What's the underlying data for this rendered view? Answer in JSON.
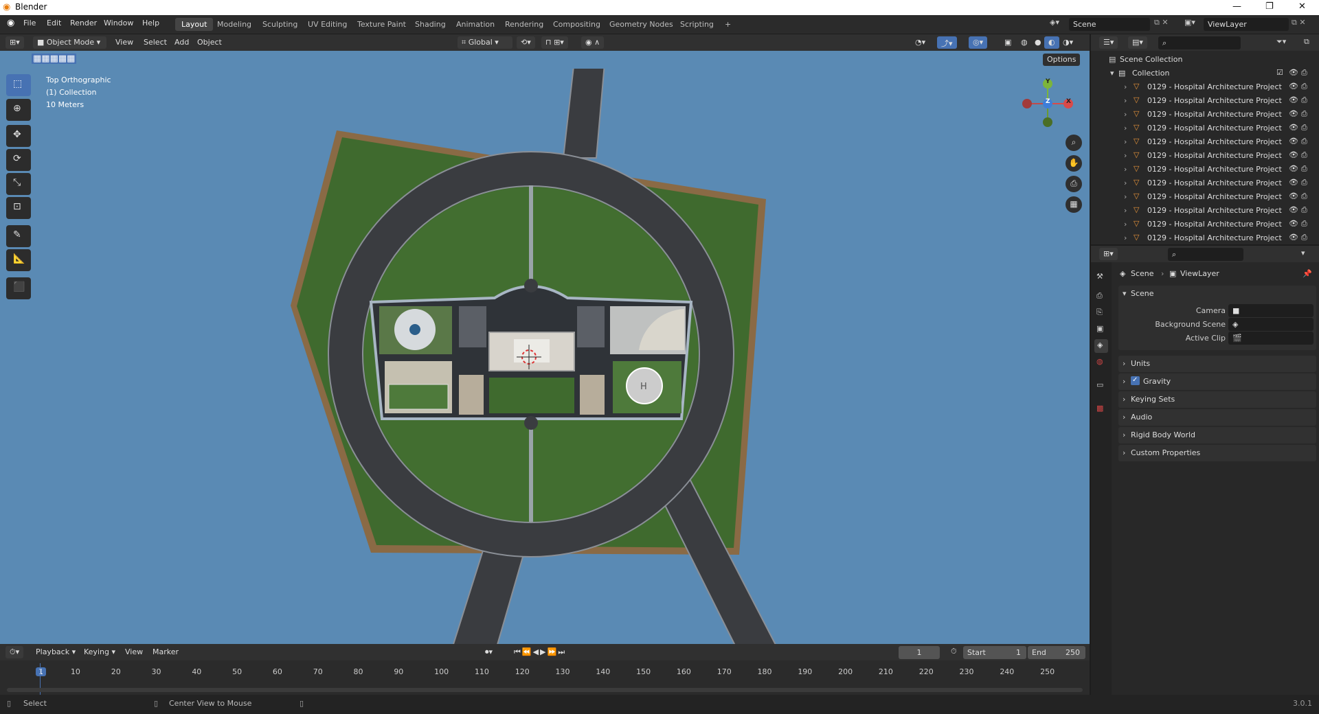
{
  "window": {
    "title": "Blender"
  },
  "menu": [
    "File",
    "Edit",
    "Render",
    "Window",
    "Help"
  ],
  "workspaces": [
    "Layout",
    "Modeling",
    "Sculpting",
    "UV Editing",
    "Texture Paint",
    "Shading",
    "Animation",
    "Rendering",
    "Compositing",
    "Geometry Nodes",
    "Scripting",
    "+"
  ],
  "active_workspace": "Layout",
  "scene_field": "Scene",
  "viewlayer_field": "ViewLayer",
  "viewport_header": {
    "mode": "Object Mode",
    "view": "View",
    "select": "Select",
    "add": "Add",
    "object": "Object",
    "transform": "Global",
    "options": "Options"
  },
  "viewport_overlay": {
    "view_name": "Top Orthographic",
    "collection": "(1) Collection",
    "scale": "10 Meters"
  },
  "gizmo": {
    "y": "Y",
    "z": "Z",
    "x": "X"
  },
  "outliner": {
    "root": "Scene Collection",
    "collection": "Collection",
    "items": [
      "0129 - Hospital Architecture Project",
      "0129 - Hospital Architecture Project",
      "0129 - Hospital Architecture Project",
      "0129 - Hospital Architecture Project",
      "0129 - Hospital Architecture Project",
      "0129 - Hospital Architecture Project",
      "0129 - Hospital Architecture Project",
      "0129 - Hospital Architecture Project",
      "0129 - Hospital Architecture Project",
      "0129 - Hospital Architecture Project",
      "0129 - Hospital Architecture Project",
      "0129 - Hospital Architecture Project"
    ]
  },
  "properties": {
    "breadcrumb_scene": "Scene",
    "breadcrumb_viewlayer": "ViewLayer",
    "section": "Scene",
    "camera_label": "Camera",
    "background_label": "Background Scene",
    "clip_label": "Active Clip",
    "panels": [
      "Units",
      "Gravity",
      "Keying Sets",
      "Audio",
      "Rigid Body World",
      "Custom Properties"
    ],
    "gravity_checked": true
  },
  "timeline": {
    "playback": "Playback",
    "keying": "Keying",
    "view": "View",
    "marker": "Marker",
    "current_frame": "1",
    "start_label": "Start",
    "start": "1",
    "end_label": "End",
    "end": "250",
    "ticks": [
      "1",
      "10",
      "20",
      "30",
      "40",
      "50",
      "60",
      "70",
      "80",
      "90",
      "100",
      "110",
      "120",
      "130",
      "140",
      "150",
      "160",
      "170",
      "180",
      "190",
      "200",
      "210",
      "220",
      "230",
      "240",
      "250"
    ]
  },
  "status": {
    "select": "Select",
    "center": "Center View to Mouse",
    "version": "3.0.1"
  },
  "colors": {
    "accent": "#4772b3",
    "viewport_bg": "#5a8ab4",
    "ground": "#3f6a2e",
    "soil": "#8a6a45",
    "road": "#3a3c40"
  }
}
